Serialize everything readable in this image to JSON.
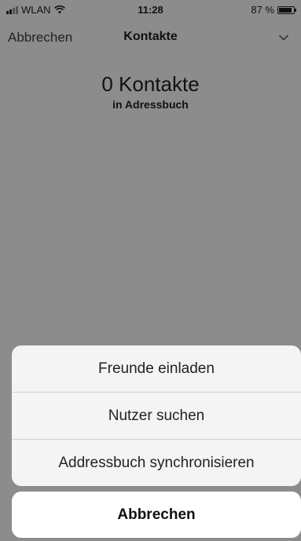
{
  "status_bar": {
    "carrier": "WLAN",
    "time": "11:28",
    "battery": "87 %",
    "battery_level": 0.87
  },
  "nav": {
    "cancel_label": "Abbrechen",
    "title": "Kontakte",
    "chevron_icon": "chevron-down-icon"
  },
  "summary": {
    "count_text": "0 Kontakte",
    "subtitle": "in Adressbuch"
  },
  "action_sheet": {
    "items": [
      {
        "label": "Freunde einladen"
      },
      {
        "label": "Nutzer suchen"
      },
      {
        "label": "Addressbuch synchronisieren"
      }
    ],
    "cancel_label": "Abbrechen"
  },
  "colors": {
    "dimmed_background": "#8c8c8c",
    "sheet_background": "#f4f4f4",
    "cancel_background": "#ffffff"
  }
}
